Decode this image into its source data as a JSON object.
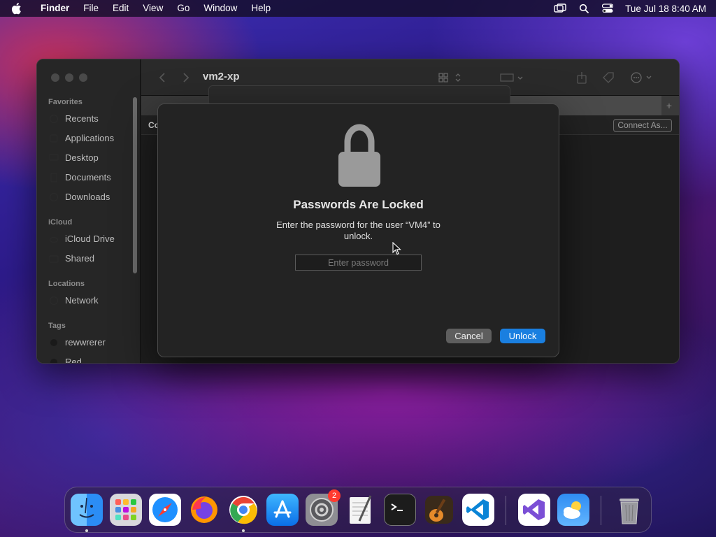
{
  "menubar": {
    "app_name": "Finder",
    "items": [
      "File",
      "Edit",
      "View",
      "Go",
      "Window",
      "Help"
    ],
    "clock": "Tue Jul 18  8:40 AM"
  },
  "finder": {
    "title": "vm2-xp",
    "sidebar": {
      "favorites_label": "Favorites",
      "favorites": [
        "Recents",
        "Applications",
        "Desktop",
        "Documents",
        "Downloads"
      ],
      "icloud_label": "iCloud",
      "icloud": [
        "iCloud Drive",
        "Shared"
      ],
      "locations_label": "Locations",
      "locations": [
        "Network"
      ],
      "tags_label": "Tags",
      "tags": [
        "rewwrerer",
        "Red"
      ]
    },
    "content_label": "Co",
    "connect_button": "Connect As..."
  },
  "dialog": {
    "title": "Passwords Are Locked",
    "message": "Enter the password for the user “VM4” to unlock.",
    "password_placeholder": "Enter password",
    "password_value": "",
    "cancel_label": "Cancel",
    "unlock_label": "Unlock"
  },
  "dock": {
    "apps": [
      "Finder",
      "Launchpad",
      "Safari",
      "Firefox",
      "Chrome",
      "App Store",
      "System Settings",
      "TextEdit",
      "Terminal",
      "GarageBand",
      "Visual Studio Code",
      "Visual Studio",
      "Weather",
      "Trash"
    ],
    "settings_badge": "2"
  },
  "colors": {
    "accent": "#1a7fe0",
    "badge": "#ff3b30"
  }
}
